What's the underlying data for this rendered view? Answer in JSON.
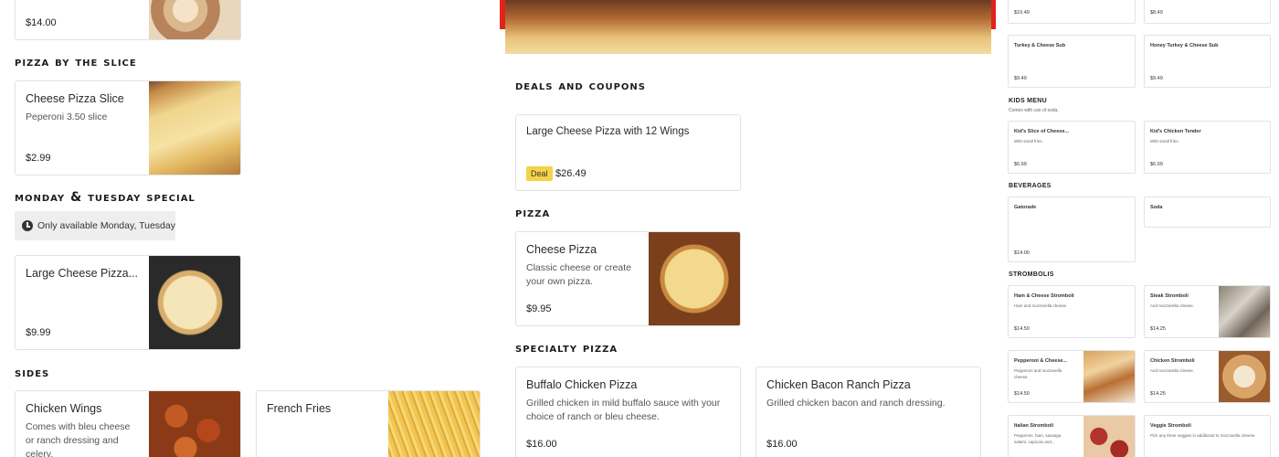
{
  "left": {
    "top_card": {
      "price": "$14.00"
    },
    "slice_section": {
      "title": "pizza by the slice"
    },
    "slice_card": {
      "title": "Cheese Pizza Slice",
      "desc": "Peperoni 3.50 slice",
      "price": "$2.99"
    },
    "special_section": {
      "title": "monday & tuesday special"
    },
    "availability": {
      "text": "Only available Monday, Tuesday"
    },
    "special_card": {
      "title": "Large Cheese Pizza...",
      "price": "$9.99"
    },
    "sides_section": {
      "title": "sides"
    },
    "wings_card": {
      "title": "Chicken Wings",
      "desc": "Comes with bleu cheese or ranch dressing and celery."
    },
    "fries_card": {
      "title": "French Fries"
    }
  },
  "middle": {
    "deals_section": {
      "title": "deals and coupons"
    },
    "deal_card": {
      "title": "Large Cheese Pizza with 12 Wings",
      "badge": "Deal",
      "price": "$26.49"
    },
    "pizza_section": {
      "title": "pizza"
    },
    "pizza_card": {
      "title": "Cheese Pizza",
      "desc": "Classic cheese or create your own pizza.",
      "price": "$9.95"
    },
    "specialty_section": {
      "title": "specialty pizza"
    },
    "buffalo_card": {
      "title": "Buffalo Chicken Pizza",
      "desc": "Grilled chicken in mild buffalo sauce with your choice of ranch or bleu cheese.",
      "price": "$16.00"
    },
    "bacon_card": {
      "title": "Chicken Bacon Ranch Pizza",
      "desc": "Grilled chicken bacon and ranch dressing.",
      "price": "$16.00"
    }
  },
  "right": {
    "top_prices": [
      "$10.49",
      "$8.49"
    ],
    "subs": [
      {
        "title": "Turkey & Cheese Sub",
        "price": "$9.49"
      },
      {
        "title": "Honey Turkey & Cheese Sub",
        "price": "$9.49"
      }
    ],
    "kids_section": {
      "title": "KIDS MENU",
      "subtitle": "Comes with can of soda."
    },
    "kids": [
      {
        "title": "Kid's Slice of Cheese...",
        "desc": "With small fries.",
        "price": "$6.99"
      },
      {
        "title": "Kid's Chicken Tender",
        "desc": "With small fries.",
        "price": "$6.99"
      }
    ],
    "beverages_section": {
      "title": "BEVERAGES"
    },
    "beverages": [
      {
        "title": "Gatorade",
        "price": "$14.00"
      },
      {
        "title": "Soda"
      }
    ],
    "strombolis_section": {
      "title": "STROMBOLIS"
    },
    "strombolis": [
      {
        "title": "Ham & Cheese Stromboli",
        "desc": "Ham and mozzarella cheese.",
        "price": "$14.50"
      },
      {
        "title": "Steak Stromboli",
        "desc": "And mozzarella cheese.",
        "price": "$14.25"
      },
      {
        "title": "Pepperoni & Cheese...",
        "desc": "Pepperoni and mozzarella cheese.",
        "price": "$14.50"
      },
      {
        "title": "Chicken Stromboli",
        "desc": "And mozzarella cheese.",
        "price": "$14.25"
      },
      {
        "title": "Italian Stromboli",
        "desc": "Pepperoni, ham, sausage, salami, capicola and..."
      },
      {
        "title": "Veggie Stromboli",
        "desc": "Pick any three veggies in additional to mozzarella cheese."
      }
    ]
  },
  "colors": {
    "accent": "#e2231a",
    "deal_badge": "#f3d349",
    "border": "#e2e2e2"
  }
}
